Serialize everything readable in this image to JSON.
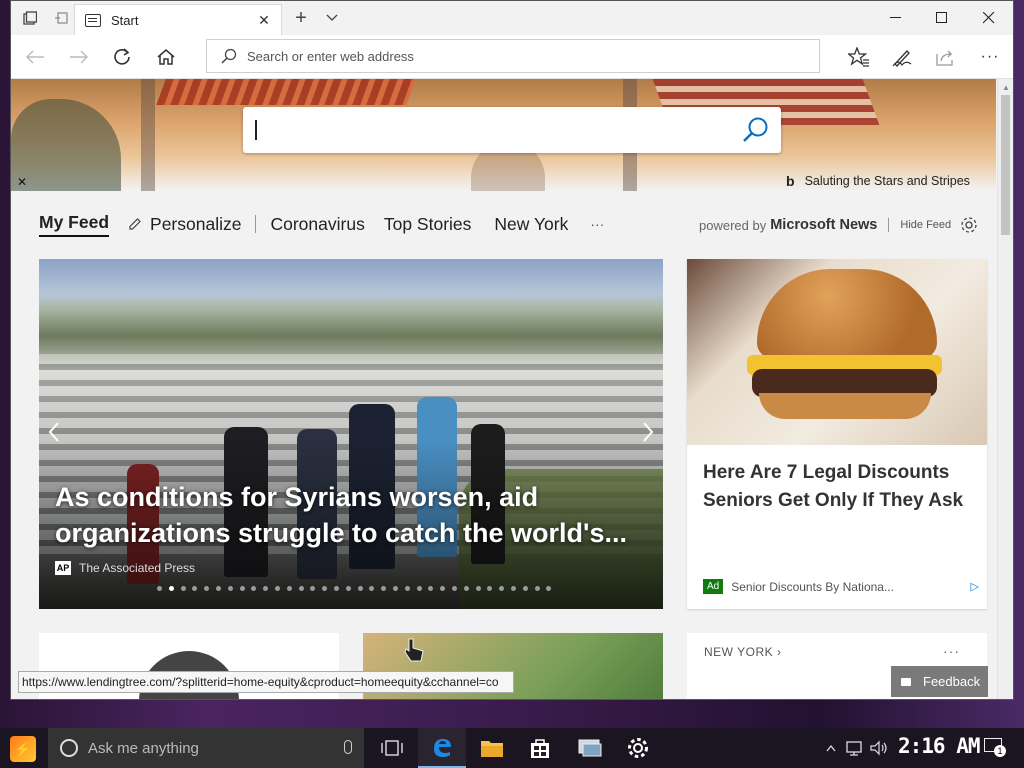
{
  "browser": {
    "tab_title": "Start",
    "address_placeholder": "Search or enter web address"
  },
  "hero": {
    "caption": "Saluting the Stars and Stripes"
  },
  "feed_nav": {
    "my_feed": "My Feed",
    "personalize": "Personalize",
    "items": [
      "Coronavirus",
      "Top Stories",
      "New York"
    ],
    "more": "···"
  },
  "powered": {
    "prefix": "powered by",
    "brand": "Microsoft News",
    "hide": "Hide Feed"
  },
  "main_story": {
    "title": "As conditions for Syrians worsen, aid organizations struggle to catch the world's...",
    "source": "The Associated Press",
    "source_logo": "AP",
    "carousel_total": 34,
    "carousel_active": 2
  },
  "ad": {
    "title": "Here Are 7 Legal Discounts Seniors Get Only If They Ask",
    "badge": "Ad",
    "sponsor": "Senior Discounts By Nationa..."
  },
  "new_york_card": {
    "label": "NEW YORK",
    "more": "···"
  },
  "feedback": "Feedback",
  "status_url": "https://www.lendingtree.com/?splitterid=home-equity&cproduct=homeequity&cchannel=co",
  "taskbar": {
    "search_placeholder": "Ask me anything",
    "clock": "2:16 AM",
    "notifications": "1"
  }
}
